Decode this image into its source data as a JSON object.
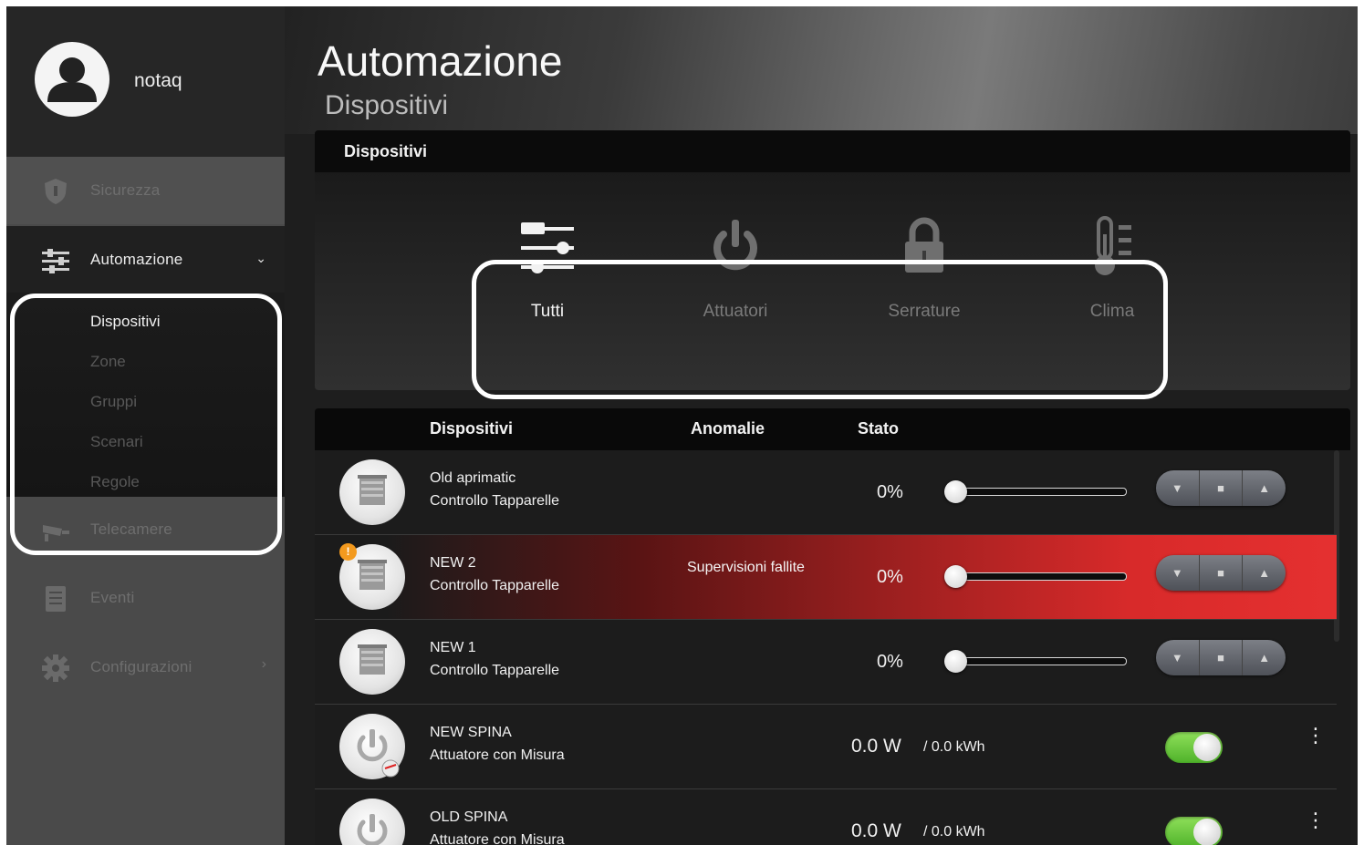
{
  "user": {
    "name": "notaq"
  },
  "nav": {
    "sicurezza": "Sicurezza",
    "automazione": "Automazione",
    "telecamere": "Telecamere",
    "eventi": "Eventi",
    "configurazioni": "Configurazioni",
    "submenu": [
      "Dispositivi",
      "Zone",
      "Gruppi",
      "Scenari",
      "Regole"
    ]
  },
  "page": {
    "title": "Automazione",
    "subtitle": "Dispositivi"
  },
  "categories": {
    "title": "Dispositivi",
    "tabs": [
      {
        "label": "Tutti",
        "icon": "sliders-icon",
        "active": true
      },
      {
        "label": "Attuatori",
        "icon": "power-icon",
        "active": false
      },
      {
        "label": "Serrature",
        "icon": "lock-icon",
        "active": false
      },
      {
        "label": "Clima",
        "icon": "thermometer-icon",
        "active": false
      }
    ]
  },
  "table": {
    "headers": {
      "devices": "Dispositivi",
      "anomalies": "Anomalie",
      "state": "Stato"
    },
    "rows": [
      {
        "name": "Old aprimatic",
        "type": "Controllo Tapparelle",
        "anomaly": "",
        "state": "0%",
        "level": 0,
        "icon": "shutter-icon"
      },
      {
        "name": "NEW 2",
        "type": "Controllo Tapparelle",
        "anomaly": "Supervisioni fallite",
        "state": "0%",
        "level": 0,
        "badge": "!",
        "icon": "shutter-icon"
      },
      {
        "name": "NEW 1",
        "type": "Controllo Tapparelle",
        "anomaly": "",
        "state": "0%",
        "level": 0,
        "icon": "shutter-icon"
      },
      {
        "name": "NEW SPINA",
        "type": "Attuatore con Misura",
        "power": "0.0 W",
        "energy": "/ 0.0 kWh",
        "on": true,
        "icon": "plug-meter-icon"
      },
      {
        "name": "OLD SPINA",
        "type": "Attuatore con Misura",
        "power": "0.0 W",
        "energy": "/ 0.0 kWh",
        "on": true,
        "icon": "plug-meter-icon"
      }
    ]
  },
  "colors": {
    "alert_row": "#e53030",
    "toggle_on": "#5cc234",
    "badge": "#f39a1e"
  }
}
